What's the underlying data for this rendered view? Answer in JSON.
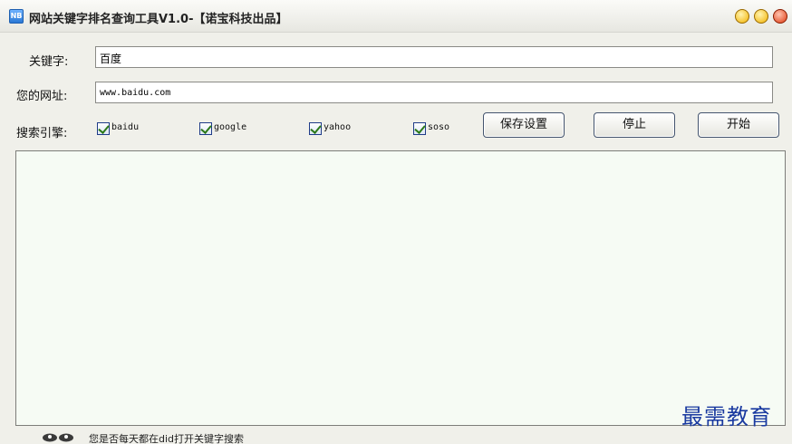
{
  "window": {
    "title": "网站关键字排名查询工具V1.0-【诺宝科技出品】",
    "app_icon_text": "NB"
  },
  "form": {
    "keyword_label": "关键字:",
    "keyword_value": "百度",
    "url_label": "您的网址:",
    "url_value": "www.baidu.com",
    "engines_label": "搜索引擎:"
  },
  "engines": [
    {
      "label": "baidu",
      "checked": true
    },
    {
      "label": "google",
      "checked": true
    },
    {
      "label": "yahoo",
      "checked": true
    },
    {
      "label": "soso",
      "checked": true
    }
  ],
  "buttons": {
    "save": "保存设置",
    "stop": "停止",
    "start": "开始"
  },
  "watermark": "最需教育",
  "status": {
    "text": "您是否每天都在did打开关键字搜索"
  }
}
